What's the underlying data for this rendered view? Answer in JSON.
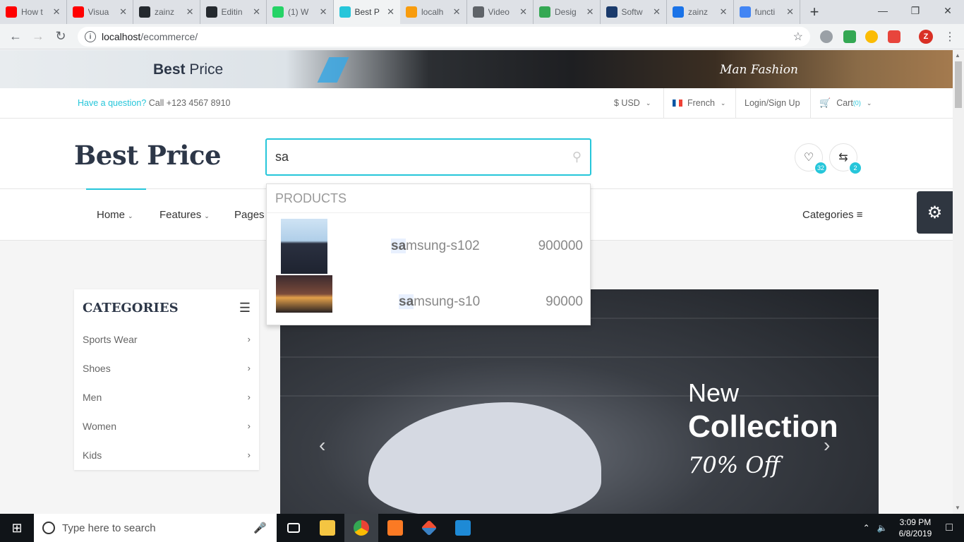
{
  "browser": {
    "tabs": [
      {
        "label": "How t",
        "icon": "youtube-icon",
        "color": "#ff0000"
      },
      {
        "label": "Visua",
        "icon": "youtube-icon",
        "color": "#ff0000"
      },
      {
        "label": "zainz",
        "icon": "github-icon",
        "color": "#24292e"
      },
      {
        "label": "Editin",
        "icon": "github-icon",
        "color": "#24292e"
      },
      {
        "label": "(1) W",
        "icon": "whatsapp-icon",
        "color": "#25d366"
      },
      {
        "label": "Best P",
        "icon": "bag-icon",
        "color": "#26c6da"
      },
      {
        "label": "localh",
        "icon": "phpmyadmin-icon",
        "color": "#f89c0e"
      },
      {
        "label": "Video",
        "icon": "globe-icon",
        "color": "#5f6368"
      },
      {
        "label": "Desig",
        "icon": "design-icon",
        "color": "#34a853"
      },
      {
        "label": "Softw",
        "icon": "software-icon",
        "color": "#1a3a6b"
      },
      {
        "label": "zainz",
        "icon": "fn-icon",
        "color": "#1a73e8"
      },
      {
        "label": "functi",
        "icon": "google-icon",
        "color": "#4285f4"
      }
    ],
    "active_tab": 5,
    "url_host": "localhost",
    "url_path": "/ecommerce/",
    "profile_initial": "Z"
  },
  "banner": {
    "brand_bold": "Best",
    "brand_rest": " Price",
    "right_text": "Man Fashion"
  },
  "infobar": {
    "question": "Have a question?",
    "call": " Call +123 4567 8910",
    "currency": "$  USD",
    "language": "French",
    "login": "Login/Sign Up",
    "cart": "Cart",
    "cart_count": "(0)"
  },
  "header": {
    "logo": "Best Price",
    "search_value": "sa",
    "wishlist_count": "32",
    "compare_count": "2"
  },
  "nav": {
    "items": [
      "Home",
      "Features",
      "Pages"
    ],
    "categories_label": "Categories"
  },
  "dropdown": {
    "heading": "PRODUCTS",
    "results": [
      {
        "match": "sa",
        "rest": "msung-s102",
        "price": "900000"
      },
      {
        "match": "sa",
        "rest": "msung-s10",
        "price": "90000"
      }
    ]
  },
  "sidebar": {
    "title": "CATEGORIES",
    "items": [
      "Sports Wear",
      "Shoes",
      "Men",
      "Women",
      "Kids"
    ]
  },
  "hero": {
    "line1": "New",
    "line2": "Collection",
    "line3": "70% Off"
  },
  "taskbar": {
    "search_placeholder": "Type here to search",
    "time": "3:09 PM",
    "date": "6/8/2019"
  }
}
